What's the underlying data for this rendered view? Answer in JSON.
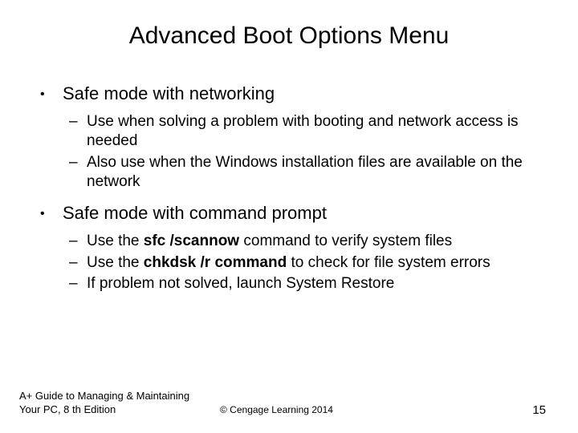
{
  "title": "Advanced Boot Options Menu",
  "bullets": [
    {
      "text": "Safe mode with networking",
      "subs": [
        {
          "text": "Use when solving a problem with booting and network access is needed"
        },
        {
          "text": "Also use when the Windows installation files are available on the network"
        }
      ]
    },
    {
      "text": "Safe mode with command prompt",
      "subs": [
        {
          "prefix": "Use the ",
          "bold": "sfc /scannow",
          "suffix": " command to verify system files"
        },
        {
          "prefix": "Use the ",
          "bold": "chkdsk /r command",
          "suffix": " to check for file system errors"
        },
        {
          "text": "If problem not solved, launch System Restore"
        }
      ]
    }
  ],
  "footer": {
    "left": "A+ Guide to Managing & Maintaining Your PC, 8 th Edition",
    "center": "© Cengage Learning  2014",
    "page": "15"
  }
}
